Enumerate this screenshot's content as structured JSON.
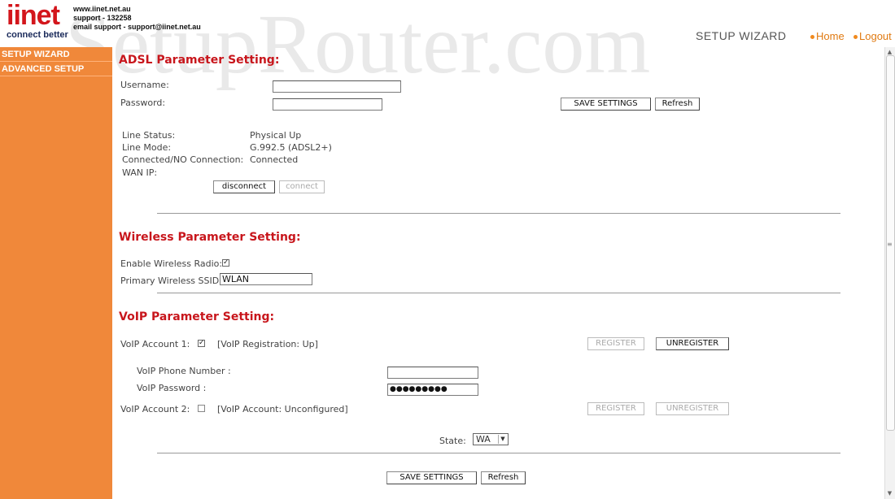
{
  "header": {
    "logo_main": "iinet",
    "logo_tagline": "connect better",
    "lines": [
      "www.iinet.net.au",
      "support - 132258",
      "email support - support@iinet.net.au"
    ],
    "watermark": "SetupRouter.com",
    "wizard_title": "SETUP WIZARD",
    "home_label": "Home",
    "logout_label": "Logout"
  },
  "sidebar": {
    "items": [
      {
        "label": "SETUP WIZARD"
      },
      {
        "label": "ADVANCED SETUP"
      }
    ]
  },
  "adsl": {
    "title": "ADSL Parameter Setting:",
    "username_label": "Username:",
    "username_value": "",
    "password_label": "Password:",
    "password_value": "",
    "save_label": "SAVE SETTINGS",
    "refresh_label": "Refresh",
    "line_status_label": "Line Status:",
    "line_status_value": "Physical Up",
    "line_mode_label": "Line Mode:",
    "line_mode_value": "G.992.5 (ADSL2+)",
    "connection_label": "Connected/NO Connection:",
    "connection_value": "Connected",
    "wan_ip_label": "WAN IP:",
    "wan_ip_value": "",
    "disconnect_label": "disconnect",
    "connect_label": "connect"
  },
  "wireless": {
    "title": "Wireless Parameter Setting:",
    "enable_label": "Enable Wireless Radio:",
    "enable_checked": true,
    "ssid_label": "Primary Wireless SSID:",
    "ssid_value": "WLAN"
  },
  "voip": {
    "title": "VoIP Parameter Setting:",
    "account1_label": "VoIP Account 1:",
    "account1_checked": true,
    "account1_status": "[VoIP Registration: Up]",
    "register_label": "REGISTER",
    "unregister_label": "UNREGISTER",
    "phone_label": "VoIP Phone Number :",
    "phone_value": "",
    "password_label": "VoIP Password :",
    "password_value": "●●●●●●●●●",
    "account2_label": "VoIP Account 2:",
    "account2_checked": false,
    "account2_status": "[VoIP Account: Unconfigured]",
    "state_label": "State:",
    "state_value": "WA"
  },
  "footer": {
    "save_label": "SAVE SETTINGS",
    "refresh_label": "Refresh"
  }
}
